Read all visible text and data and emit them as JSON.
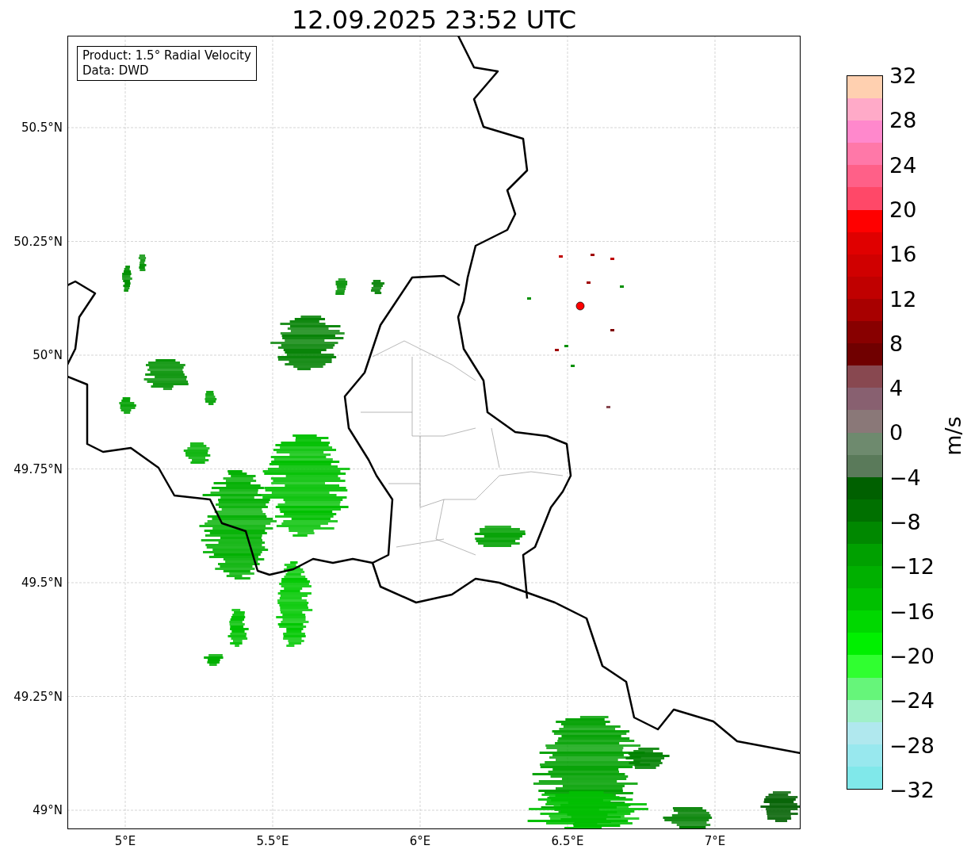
{
  "title": "12.09.2025 23:52 UTC",
  "info_box": [
    "Product: 1.5° Radial Velocity",
    "Data: DWD"
  ],
  "y_axis": {
    "ticks": [
      "50.5°N",
      "50.25°N",
      "50°N",
      "49.75°N",
      "49.5°N",
      "49.25°N",
      "49°N"
    ]
  },
  "x_axis": {
    "ticks": [
      "5°E",
      "5.5°E",
      "6°E",
      "6.5°E",
      "7°E"
    ]
  },
  "colorbar": {
    "label": "m/s",
    "ticks": [
      "32",
      "28",
      "24",
      "20",
      "16",
      "12",
      "8",
      "4",
      "0",
      "−4",
      "−8",
      "−12",
      "−16",
      "−20",
      "−24",
      "−28",
      "−32"
    ],
    "bands": [
      {
        "color": "#ffd0b0"
      },
      {
        "color": "#ffaac8"
      },
      {
        "color": "#ff88cc"
      },
      {
        "color": "#ff78a8"
      },
      {
        "color": "#ff6088"
      },
      {
        "color": "#ff4868"
      },
      {
        "color": "#ff0000"
      },
      {
        "color": "#e00000"
      },
      {
        "color": "#d00000"
      },
      {
        "color": "#c00000"
      },
      {
        "color": "#a80000"
      },
      {
        "color": "#880000"
      },
      {
        "color": "#700000"
      },
      {
        "color": "#884850"
      },
      {
        "color": "#886070"
      },
      {
        "color": "#8a7878"
      },
      {
        "color": "#6e8a6e"
      },
      {
        "color": "#5a7a5a"
      },
      {
        "color": "#006000"
      },
      {
        "color": "#007000"
      },
      {
        "color": "#008800"
      },
      {
        "color": "#00a000"
      },
      {
        "color": "#00b000"
      },
      {
        "color": "#00c000"
      },
      {
        "color": "#00d800"
      },
      {
        "color": "#00f000"
      },
      {
        "color": "#30ff30"
      },
      {
        "color": "#66f57a"
      },
      {
        "color": "#a0f0c8"
      },
      {
        "color": "#b0e8ee"
      },
      {
        "color": "#98e8ee"
      },
      {
        "color": "#80e8ea"
      }
    ]
  }
}
